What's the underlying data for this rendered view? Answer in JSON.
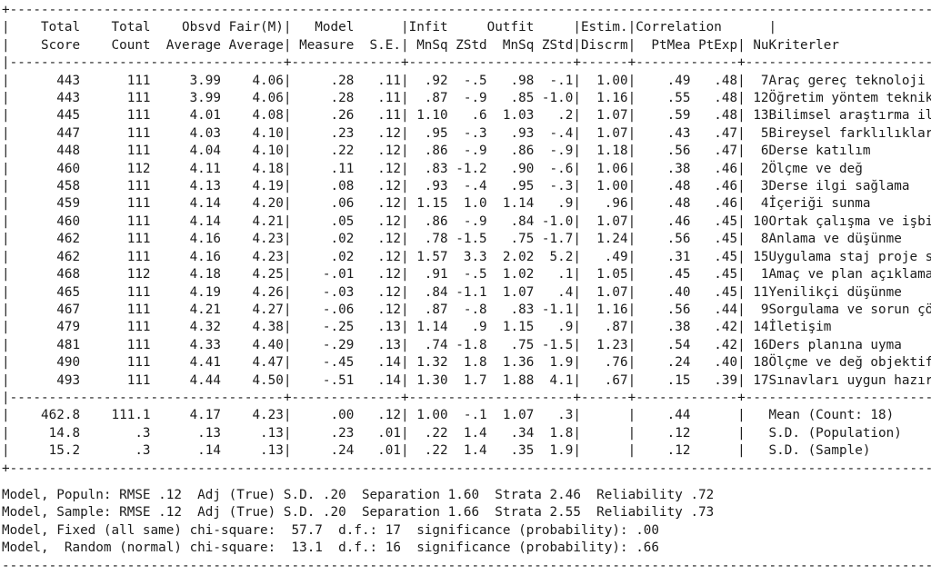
{
  "report": {
    "type": "facets-measurement-report",
    "table_width_chars": 118,
    "columns": [
      {
        "key": "total_score",
        "header_line1": "Total",
        "header_line2": "Score",
        "width": 9,
        "align": "right"
      },
      {
        "key": "total_count",
        "header_line1": "Total",
        "header_line2": "Count",
        "width": 9,
        "align": "right"
      },
      {
        "key": "obsvd_average",
        "header_line1": "Obsvd",
        "header_line2": "Average",
        "width": 9,
        "align": "right"
      },
      {
        "key": "fair_average",
        "header_line1": "Fair(M)",
        "header_line2": "Average",
        "width": 8,
        "align": "right"
      },
      {
        "key": "measure",
        "header_line1": "Model",
        "header_line2": "Measure",
        "width": 8,
        "align": "right"
      },
      {
        "key": "se",
        "header_line1": "",
        "header_line2": "S.E.",
        "width": 6,
        "align": "right"
      },
      {
        "key": "infit_mnsq",
        "header_line1": "Infit",
        "header_line2": "MnSq",
        "width": 5,
        "align": "right"
      },
      {
        "key": "infit_zstd",
        "header_line1": "",
        "header_line2": "ZStd",
        "width": 5,
        "align": "right"
      },
      {
        "key": "outfit_mnsq",
        "header_line1": "Outfit",
        "header_line2": "MnSq",
        "width": 6,
        "align": "right"
      },
      {
        "key": "outfit_zstd",
        "header_line1": "",
        "header_line2": "ZStd",
        "width": 5,
        "align": "right"
      },
      {
        "key": "discrm",
        "header_line1": "Estim.",
        "header_line2": "Discrm",
        "width": 6,
        "align": "right"
      },
      {
        "key": "ptmea",
        "header_line1": "Correlation",
        "header_line2": "PtMea",
        "width": 7,
        "align": "right"
      },
      {
        "key": "ptexp",
        "header_line1": "",
        "header_line2": "PtExp",
        "width": 6,
        "align": "right"
      },
      {
        "key": "nu",
        "header_line1": "",
        "header_line2": "Nu",
        "width": 3,
        "align": "right"
      },
      {
        "key": "kriterler",
        "header_line1": "",
        "header_line2": "Kriterler",
        "width": 33,
        "align": "left"
      }
    ],
    "header_group_labels": [
      "Total Score",
      "Total Count",
      "Obsvd Average",
      "Fair(M) Average",
      "Model Measure",
      "Model S.E.",
      "Infit MnSq",
      "Infit ZStd",
      "Outfit MnSq",
      "Outfit ZStd",
      "Estim. Discrm",
      "Correlation PtMea",
      "Correlation PtExp",
      "Nu",
      "Kriterler"
    ],
    "rows": [
      {
        "total_score": "443",
        "total_count": "111",
        "obsvd_average": "3.99",
        "fair_average": "4.06",
        "measure": ".28",
        "se": ".11",
        "infit_mnsq": ".92",
        "infit_zstd": "-.5",
        "outfit_mnsq": ".98",
        "outfit_zstd": "-.1",
        "discrm": "1.00",
        "ptmea": ".49",
        "ptexp": ".48",
        "nu": "7",
        "kriterler": "Araç gereç teknoloji kullanma"
      },
      {
        "total_score": "443",
        "total_count": "111",
        "obsvd_average": "3.99",
        "fair_average": "4.06",
        "measure": ".28",
        "se": ".11",
        "infit_mnsq": ".87",
        "infit_zstd": "-.9",
        "outfit_mnsq": ".85",
        "outfit_zstd": "-1.0",
        "discrm": "1.16",
        "ptmea": ".55",
        "ptexp": ".48",
        "nu": "12",
        "kriterler": "Öğretim yöntem teknikleri"
      },
      {
        "total_score": "445",
        "total_count": "111",
        "obsvd_average": "4.01",
        "fair_average": "4.08",
        "measure": ".26",
        "se": ".11",
        "infit_mnsq": "1.10",
        "infit_zstd": ".6",
        "outfit_mnsq": "1.03",
        "outfit_zstd": ".2",
        "discrm": "1.07",
        "ptmea": ".59",
        "ptexp": ".48",
        "nu": "13",
        "kriterler": "Bilimsel araştırma ilişkilendirme"
      },
      {
        "total_score": "447",
        "total_count": "111",
        "obsvd_average": "4.03",
        "fair_average": "4.10",
        "measure": ".23",
        "se": ".12",
        "infit_mnsq": ".95",
        "infit_zstd": "-.3",
        "outfit_mnsq": ".93",
        "outfit_zstd": "-.4",
        "discrm": "1.07",
        "ptmea": ".43",
        "ptexp": ".47",
        "nu": "5",
        "kriterler": "Bireysel farklılıklar"
      },
      {
        "total_score": "448",
        "total_count": "111",
        "obsvd_average": "4.04",
        "fair_average": "4.10",
        "measure": ".22",
        "se": ".12",
        "infit_mnsq": ".86",
        "infit_zstd": "-.9",
        "outfit_mnsq": ".86",
        "outfit_zstd": "-.9",
        "discrm": "1.18",
        "ptmea": ".56",
        "ptexp": ".47",
        "nu": "6",
        "kriterler": "Derse katılım"
      },
      {
        "total_score": "460",
        "total_count": "112",
        "obsvd_average": "4.11",
        "fair_average": "4.18",
        "measure": ".11",
        "se": ".12",
        "infit_mnsq": ".83",
        "infit_zstd": "-1.2",
        "outfit_mnsq": ".90",
        "outfit_zstd": "-.6",
        "discrm": "1.06",
        "ptmea": ".38",
        "ptexp": ".46",
        "nu": "2",
        "kriterler": "Ölçme ve değ"
      },
      {
        "total_score": "458",
        "total_count": "111",
        "obsvd_average": "4.13",
        "fair_average": "4.19",
        "measure": ".08",
        "se": ".12",
        "infit_mnsq": ".93",
        "infit_zstd": "-.4",
        "outfit_mnsq": ".95",
        "outfit_zstd": "-.3",
        "discrm": "1.00",
        "ptmea": ".48",
        "ptexp": ".46",
        "nu": "3",
        "kriterler": "Derse ilgi sağlama"
      },
      {
        "total_score": "459",
        "total_count": "111",
        "obsvd_average": "4.14",
        "fair_average": "4.20",
        "measure": ".06",
        "se": ".12",
        "infit_mnsq": "1.15",
        "infit_zstd": "1.0",
        "outfit_mnsq": "1.14",
        "outfit_zstd": ".9",
        "discrm": ".96",
        "ptmea": ".48",
        "ptexp": ".46",
        "nu": "4",
        "kriterler": "İçeriği sunma"
      },
      {
        "total_score": "460",
        "total_count": "111",
        "obsvd_average": "4.14",
        "fair_average": "4.21",
        "measure": ".05",
        "se": ".12",
        "infit_mnsq": ".86",
        "infit_zstd": "-.9",
        "outfit_mnsq": ".84",
        "outfit_zstd": "-1.0",
        "discrm": "1.07",
        "ptmea": ".46",
        "ptexp": ".45",
        "nu": "10",
        "kriterler": "Ortak çalışma ve işbirliği"
      },
      {
        "total_score": "462",
        "total_count": "111",
        "obsvd_average": "4.16",
        "fair_average": "4.23",
        "measure": ".02",
        "se": ".12",
        "infit_mnsq": ".78",
        "infit_zstd": "-1.5",
        "outfit_mnsq": ".75",
        "outfit_zstd": "-1.7",
        "discrm": "1.24",
        "ptmea": ".56",
        "ptexp": ".45",
        "nu": "8",
        "kriterler": "Anlama ve düşünme"
      },
      {
        "total_score": "462",
        "total_count": "111",
        "obsvd_average": "4.16",
        "fair_average": "4.23",
        "measure": ".02",
        "se": ".12",
        "infit_mnsq": "1.57",
        "infit_zstd": "3.3",
        "outfit_mnsq": "2.02",
        "outfit_zstd": "5.2",
        "discrm": ".49",
        "ptmea": ".31",
        "ptexp": ".45",
        "nu": "15",
        "kriterler": "Uygulama staj proje sonç paylaşımı"
      },
      {
        "total_score": "468",
        "total_count": "112",
        "obsvd_average": "4.18",
        "fair_average": "4.25",
        "measure": "-.01",
        "se": ".12",
        "infit_mnsq": ".91",
        "infit_zstd": "-.5",
        "outfit_mnsq": "1.02",
        "outfit_zstd": ".1",
        "discrm": "1.05",
        "ptmea": ".45",
        "ptexp": ".45",
        "nu": "1",
        "kriterler": "Amaç ve plan açıklama"
      },
      {
        "total_score": "465",
        "total_count": "111",
        "obsvd_average": "4.19",
        "fair_average": "4.26",
        "measure": "-.03",
        "se": ".12",
        "infit_mnsq": ".84",
        "infit_zstd": "-1.1",
        "outfit_mnsq": "1.07",
        "outfit_zstd": ".4",
        "discrm": "1.07",
        "ptmea": ".40",
        "ptexp": ".45",
        "nu": "11",
        "kriterler": "Yenilikçi düşünme"
      },
      {
        "total_score": "467",
        "total_count": "111",
        "obsvd_average": "4.21",
        "fair_average": "4.27",
        "measure": "-.06",
        "se": ".12",
        "infit_mnsq": ".87",
        "infit_zstd": "-.8",
        "outfit_mnsq": ".83",
        "outfit_zstd": "-1.1",
        "discrm": "1.16",
        "ptmea": ".56",
        "ptexp": ".44",
        "nu": "9",
        "kriterler": "Sorgulama ve sorun çözme"
      },
      {
        "total_score": "479",
        "total_count": "111",
        "obsvd_average": "4.32",
        "fair_average": "4.38",
        "measure": "-.25",
        "se": ".13",
        "infit_mnsq": "1.14",
        "infit_zstd": ".9",
        "outfit_mnsq": "1.15",
        "outfit_zstd": ".9",
        "discrm": ".87",
        "ptmea": ".38",
        "ptexp": ".42",
        "nu": "14",
        "kriterler": "İletişim"
      },
      {
        "total_score": "481",
        "total_count": "111",
        "obsvd_average": "4.33",
        "fair_average": "4.40",
        "measure": "-.29",
        "se": ".13",
        "infit_mnsq": ".74",
        "infit_zstd": "-1.8",
        "outfit_mnsq": ".75",
        "outfit_zstd": "-1.5",
        "discrm": "1.23",
        "ptmea": ".54",
        "ptexp": ".42",
        "nu": "16",
        "kriterler": "Ders planına uyma"
      },
      {
        "total_score": "490",
        "total_count": "111",
        "obsvd_average": "4.41",
        "fair_average": "4.47",
        "measure": "-.45",
        "se": ".14",
        "infit_mnsq": "1.32",
        "infit_zstd": "1.8",
        "outfit_mnsq": "1.36",
        "outfit_zstd": "1.9",
        "discrm": ".76",
        "ptmea": ".24",
        "ptexp": ".40",
        "nu": "18",
        "kriterler": "Ölçme ve değ objektif"
      },
      {
        "total_score": "493",
        "total_count": "111",
        "obsvd_average": "4.44",
        "fair_average": "4.50",
        "measure": "-.51",
        "se": ".14",
        "infit_mnsq": "1.30",
        "infit_zstd": "1.7",
        "outfit_mnsq": "1.88",
        "outfit_zstd": "4.1",
        "discrm": ".67",
        "ptmea": ".15",
        "ptexp": ".39",
        "nu": "17",
        "kriterler": "Sınavları uygun hazırlama"
      }
    ],
    "summary_rows": [
      {
        "total_score": "462.8",
        "total_count": "111.1",
        "obsvd_average": "4.17",
        "fair_average": "4.23",
        "measure": ".00",
        "se": ".12",
        "infit_mnsq": "1.00",
        "infit_zstd": "-.1",
        "outfit_mnsq": "1.07",
        "outfit_zstd": ".3",
        "discrm": "",
        "ptmea": ".44",
        "ptexp": "",
        "nu": "",
        "kriterler": "Mean (Count: 18)"
      },
      {
        "total_score": "14.8",
        "total_count": ".3",
        "obsvd_average": ".13",
        "fair_average": ".13",
        "measure": ".23",
        "se": ".01",
        "infit_mnsq": ".22",
        "infit_zstd": "1.4",
        "outfit_mnsq": ".34",
        "outfit_zstd": "1.8",
        "discrm": "",
        "ptmea": ".12",
        "ptexp": "",
        "nu": "",
        "kriterler": "S.D. (Population)"
      },
      {
        "total_score": "15.2",
        "total_count": ".3",
        "obsvd_average": ".14",
        "fair_average": ".13",
        "measure": ".24",
        "se": ".01",
        "infit_mnsq": ".22",
        "infit_zstd": "1.4",
        "outfit_mnsq": ".35",
        "outfit_zstd": "1.9",
        "discrm": "",
        "ptmea": ".12",
        "ptexp": "",
        "nu": "",
        "kriterler": "S.D. (Sample)"
      }
    ],
    "footer_lines": [
      "Model, Populn: RMSE .12  Adj (True) S.D. .20  Separation 1.60  Strata 2.46  Reliability .72",
      "Model, Sample: RMSE .12  Adj (True) S.D. .20  Separation 1.66  Strata 2.55  Reliability .73",
      "Model, Fixed (all same) chi-square:  57.7  d.f.: 17  significance (probability): .00",
      "Model,  Random (normal) chi-square:  13.1  d.f.: 16  significance (probability): .66"
    ],
    "footer_stats": {
      "populn": {
        "label": "Model, Populn:",
        "rmse_label": "RMSE",
        "rmse": ".12",
        "adj_label": "Adj (True) S.D.",
        "adj": ".20",
        "separation_label": "Separation",
        "separation": "1.60",
        "strata_label": "Strata",
        "strata": "2.46",
        "reliability_label": "Reliability",
        "reliability": ".72"
      },
      "sample": {
        "label": "Model, Sample:",
        "rmse_label": "RMSE",
        "rmse": ".12",
        "adj_label": "Adj (True) S.D.",
        "adj": ".20",
        "separation_label": "Separation",
        "separation": "1.66",
        "strata_label": "Strata",
        "strata": "2.55",
        "reliability_label": "Reliability",
        "reliability": ".73"
      },
      "fixed": {
        "label": "Model, Fixed (all same) chi-square:",
        "chi_square": "57.7",
        "df_label": "d.f.:",
        "df": "17",
        "significance_label": "significance (probability):",
        "significance": ".00"
      },
      "random": {
        "label": "Model,  Random (normal) chi-square:",
        "chi_square": "13.1",
        "df_label": "d.f.:",
        "df": "16",
        "significance_label": "significance (probability):",
        "significance": ".66"
      }
    },
    "colors": {
      "text": "#1b1b1b",
      "background": "#ffffff",
      "rule": "#2a2a2a"
    }
  }
}
